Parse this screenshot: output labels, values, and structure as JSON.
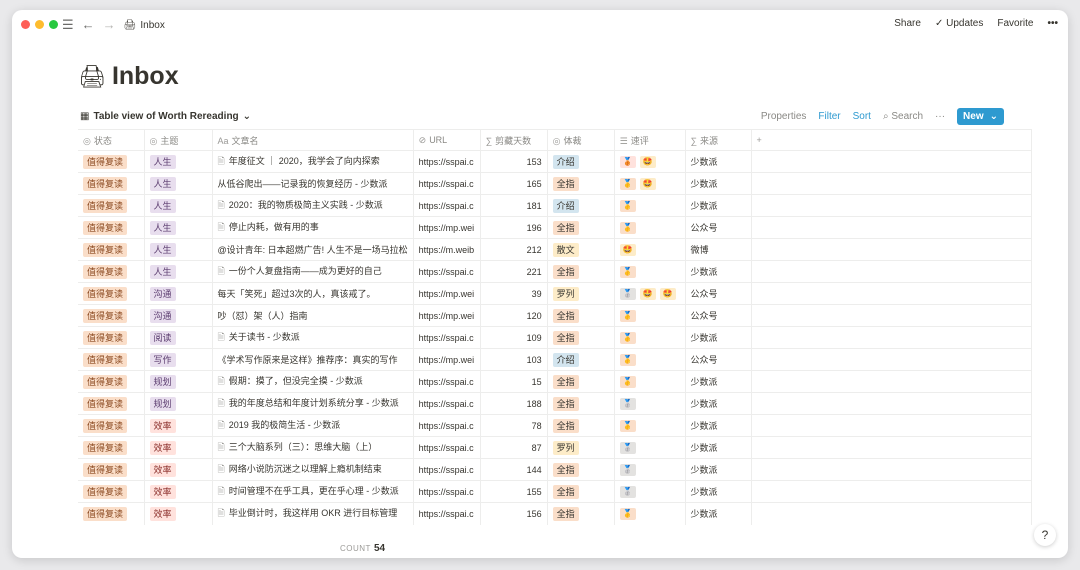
{
  "topbar": {
    "breadcrumb_emoji": "🖨",
    "breadcrumb_title": "Inbox",
    "share": "Share",
    "updates": "Updates",
    "favorite": "Favorite",
    "more": "•••"
  },
  "page": {
    "emoji": "🖨",
    "title": "Inbox"
  },
  "view": {
    "name": "Table view of Worth Rereading",
    "properties": "Properties",
    "filter": "Filter",
    "sort": "Sort",
    "search": "Search",
    "more": "···",
    "new": "New"
  },
  "columns": [
    {
      "icon": "◎",
      "label": "状态"
    },
    {
      "icon": "◎",
      "label": "主题"
    },
    {
      "icon": "Aa",
      "label": "文章名"
    },
    {
      "icon": "⊘",
      "label": "URL"
    },
    {
      "icon": "∑",
      "label": "剪藏天数"
    },
    {
      "icon": "◎",
      "label": "体裁"
    },
    {
      "icon": "☰",
      "label": "速评"
    },
    {
      "icon": "∑",
      "label": "来源"
    },
    {
      "icon": "+",
      "label": ""
    }
  ],
  "colors": {
    "status_bg": "#fadec9",
    "status_fg": "#8c4a21",
    "theme_人生": "#e8deee",
    "theme_沟通": "#e8deee",
    "theme_阅读": "#e8deee",
    "theme_写作": "#e8deee",
    "theme_规划": "#e8deee",
    "theme_效率": "#ffe2dd",
    "genre_介绍": "#d3e5ef",
    "genre_全指": "#fadec9",
    "genre_散文": "#fdecc8",
    "genre_罗列": "#fdecc8"
  },
  "rows": [
    {
      "status": "值得复读",
      "theme": "人生",
      "doc": true,
      "title": "年度征文 ｜ 2020，我学会了向内探索",
      "url": "https://sspai.c",
      "days": "153",
      "genre": "介绍",
      "review": [
        "🥉",
        "🤩"
      ],
      "source": "少数派"
    },
    {
      "status": "值得复读",
      "theme": "人生",
      "doc": false,
      "title": "从低谷爬出——记录我的恢复经历 - 少数派",
      "url": "https://sspai.c",
      "days": "165",
      "genre": "全指",
      "review": [
        "🥇",
        "🤩"
      ],
      "source": "少数派"
    },
    {
      "status": "值得复读",
      "theme": "人生",
      "doc": true,
      "title": "2020：我的物质极简主义实践 - 少数派",
      "url": "https://sspai.c",
      "days": "181",
      "genre": "介绍",
      "review": [
        "🥇"
      ],
      "source": "少数派"
    },
    {
      "status": "值得复读",
      "theme": "人生",
      "doc": true,
      "title": "停止内耗，做有用的事",
      "url": "https://mp.wei",
      "days": "196",
      "genre": "全指",
      "review": [
        "🥇"
      ],
      "source": "公众号"
    },
    {
      "status": "值得复读",
      "theme": "人生",
      "doc": false,
      "title": "@设计青年: 日本超燃广告! 人生不是一场马拉松",
      "url": "https://m.weib",
      "days": "212",
      "genre": "散文",
      "review": [
        "🤩"
      ],
      "source": "微博"
    },
    {
      "status": "值得复读",
      "theme": "人生",
      "doc": true,
      "title": "一份个人复盘指南——成为更好的自己",
      "url": "https://sspai.c",
      "days": "221",
      "genre": "全指",
      "review": [
        "🥇"
      ],
      "source": "少数派"
    },
    {
      "status": "值得复读",
      "theme": "沟通",
      "doc": false,
      "title": "每天「笑死」超过3次的人，真该戒了。",
      "url": "https://mp.wei",
      "days": "39",
      "genre": "罗列",
      "review": [
        "🥈",
        "🤩",
        "🤩"
      ],
      "source": "公众号"
    },
    {
      "status": "值得复读",
      "theme": "沟通",
      "doc": false,
      "title": "吵（怼）架（人）指南",
      "url": "https://mp.wei",
      "days": "120",
      "genre": "全指",
      "review": [
        "🥇"
      ],
      "source": "公众号"
    },
    {
      "status": "值得复读",
      "theme": "阅读",
      "doc": true,
      "title": "关于读书 - 少数派",
      "url": "https://sspai.c",
      "days": "109",
      "genre": "全指",
      "review": [
        "🥇"
      ],
      "source": "少数派"
    },
    {
      "status": "值得复读",
      "theme": "写作",
      "doc": false,
      "title": "《学术写作原来是这样》推荐序：真实的写作",
      "url": "https://mp.wei",
      "days": "103",
      "genre": "介绍",
      "review": [
        "🥇"
      ],
      "source": "公众号"
    },
    {
      "status": "值得复读",
      "theme": "规划",
      "doc": true,
      "title": "假期：摸了，但没完全摸 - 少数派",
      "url": "https://sspai.c",
      "days": "15",
      "genre": "全指",
      "review": [
        "🥇"
      ],
      "source": "少数派"
    },
    {
      "status": "值得复读",
      "theme": "规划",
      "doc": true,
      "title": "我的年度总结和年度计划系统分享 - 少数派",
      "url": "https://sspai.c",
      "days": "188",
      "genre": "全指",
      "review": [
        "🥈"
      ],
      "source": "少数派"
    },
    {
      "status": "值得复读",
      "theme": "效率",
      "doc": true,
      "title": "2019 我的极简生活 - 少数派",
      "url": "https://sspai.c",
      "days": "78",
      "genre": "全指",
      "review": [
        "🥇"
      ],
      "source": "少数派"
    },
    {
      "status": "值得复读",
      "theme": "效率",
      "doc": true,
      "title": "三个大脑系列（三）：思维大脑（上）",
      "url": "https://sspai.c",
      "days": "87",
      "genre": "罗列",
      "review": [
        "🥈"
      ],
      "source": "少数派"
    },
    {
      "status": "值得复读",
      "theme": "效率",
      "doc": true,
      "title": "网络小说防沉迷之以理解上瘾机制结束",
      "url": "https://sspai.c",
      "days": "144",
      "genre": "全指",
      "review": [
        "🥈"
      ],
      "source": "少数派"
    },
    {
      "status": "值得复读",
      "theme": "效率",
      "doc": true,
      "title": "时间管理不在乎工具，更在乎心理 - 少数派",
      "url": "https://sspai.c",
      "days": "155",
      "genre": "全指",
      "review": [
        "🥈"
      ],
      "source": "少数派"
    },
    {
      "status": "值得复读",
      "theme": "效率",
      "doc": true,
      "title": "毕业倒计时，我这样用 OKR 进行目标管理",
      "url": "https://sspai.c",
      "days": "156",
      "genre": "全指",
      "review": [
        "🥇"
      ],
      "source": "少数派"
    }
  ],
  "footer": {
    "count_label": "COUNT",
    "count_value": "54"
  },
  "help": "?"
}
